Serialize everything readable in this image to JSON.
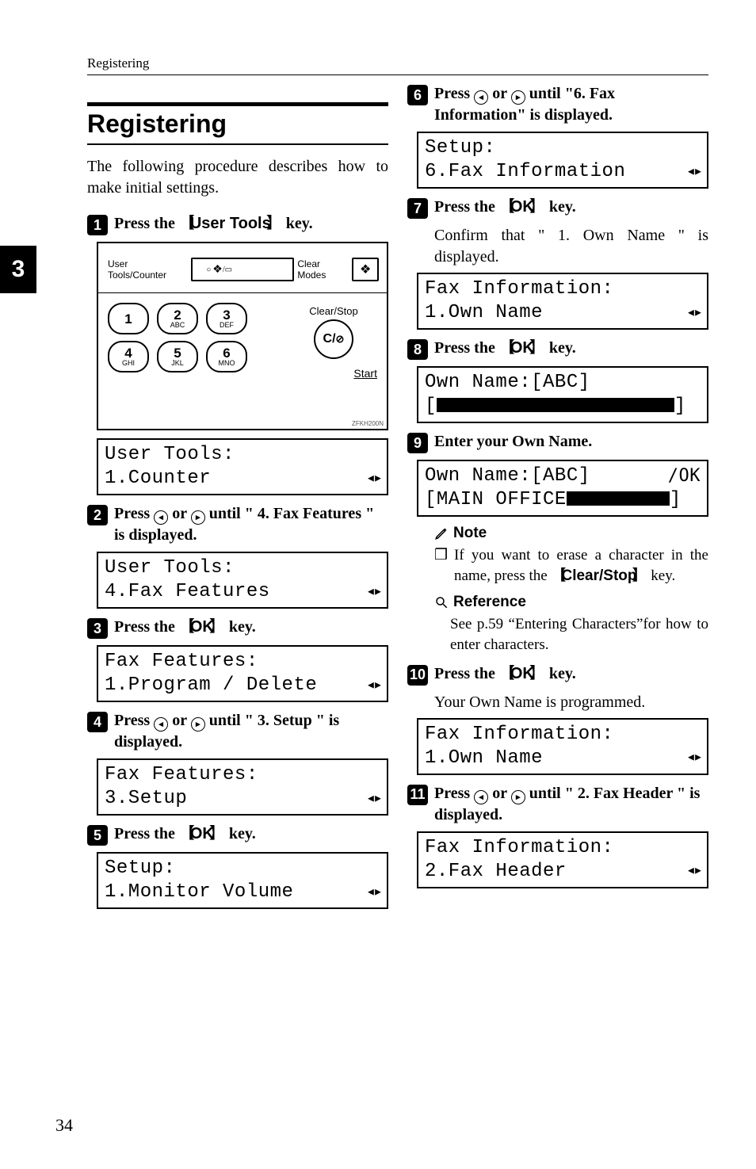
{
  "running_head": "Registering",
  "side_tab": "3",
  "title": "Registering",
  "intro": "The following procedure describes how to make initial settings.",
  "steps": {
    "s1": {
      "text_a": "Press the ",
      "key": "User Tools",
      "text_b": " key."
    },
    "s2": {
      "text_a": "Press ",
      "mid": " or ",
      "text_b": " until \" 4. Fax Features \" is displayed."
    },
    "s3": {
      "text_a": "Press the ",
      "key": "OK",
      "text_b": " key."
    },
    "s4": {
      "text_a": "Press ",
      "mid": " or ",
      "text_b": " until \" 3. Setup \" is displayed."
    },
    "s5": {
      "text_a": "Press the ",
      "key": "OK",
      "text_b": " key."
    },
    "s6": {
      "text_a": "Press ",
      "mid": " or ",
      "text_b": " until \"6. Fax Information\" is displayed."
    },
    "s7": {
      "text_a": "Press the ",
      "key": "OK",
      "text_b": " key.",
      "sub": "Confirm that \" 1. Own Name \" is displayed."
    },
    "s8": {
      "text_a": "Press the ",
      "key": "OK",
      "text_b": " key."
    },
    "s9": {
      "text": "Enter your Own Name."
    },
    "s10": {
      "text_a": "Press the ",
      "key": "OK",
      "text_b": " key.",
      "sub": "Your Own Name is programmed."
    },
    "s11": {
      "text_a": "Press ",
      "mid": " or ",
      "text_b": " until \" 2. Fax Header \" is displayed."
    }
  },
  "panel": {
    "user_tools_counter": "User Tools/Counter",
    "clear_modes": "Clear Modes",
    "clear_stop": "Clear/Stop",
    "cs_symbol": "C/",
    "start": "Start",
    "code": "ZFKH200N",
    "keys": [
      {
        "d": "1",
        "s": ""
      },
      {
        "d": "2",
        "s": "ABC"
      },
      {
        "d": "3",
        "s": "DEF"
      },
      {
        "d": "4",
        "s": "GHI"
      },
      {
        "d": "5",
        "s": "JKL"
      },
      {
        "d": "6",
        "s": "MNO"
      }
    ]
  },
  "lcd": {
    "l1a": "User Tools:",
    "l1b": "1.Counter",
    "l2a": "User Tools:",
    "l2b": "4.Fax Features",
    "l3a": "Fax Features:",
    "l3b": "1.Program / Delete",
    "l4a": "Fax Features:",
    "l4b": "3.Setup",
    "l5a": "Setup:",
    "l5b": "1.Monitor Volume",
    "l6a": "Setup:",
    "l6b": "6.Fax Information",
    "l7a": "Fax Information:",
    "l7b": "1.Own Name",
    "l8a": "Own Name:[ABC]",
    "l8b_pre": "[",
    "l8b_post": "]",
    "l9a": "Own Name:[ABC]",
    "l9a_right": "/OK",
    "l9b_pre": "[MAIN OFFICE",
    "l9b_post": "]",
    "l10a": "Fax Information:",
    "l10b": "1.Own Name",
    "l11a": "Fax Information:",
    "l11b": "2.Fax Header"
  },
  "note": {
    "head": "Note",
    "body_a": "If you want to erase a character in the name, press the ",
    "key": "Clear/Stop",
    "body_b": " key."
  },
  "reference": {
    "head": "Reference",
    "body": "See p.59 “Entering Characters”for how to enter characters."
  },
  "page_number": "34"
}
